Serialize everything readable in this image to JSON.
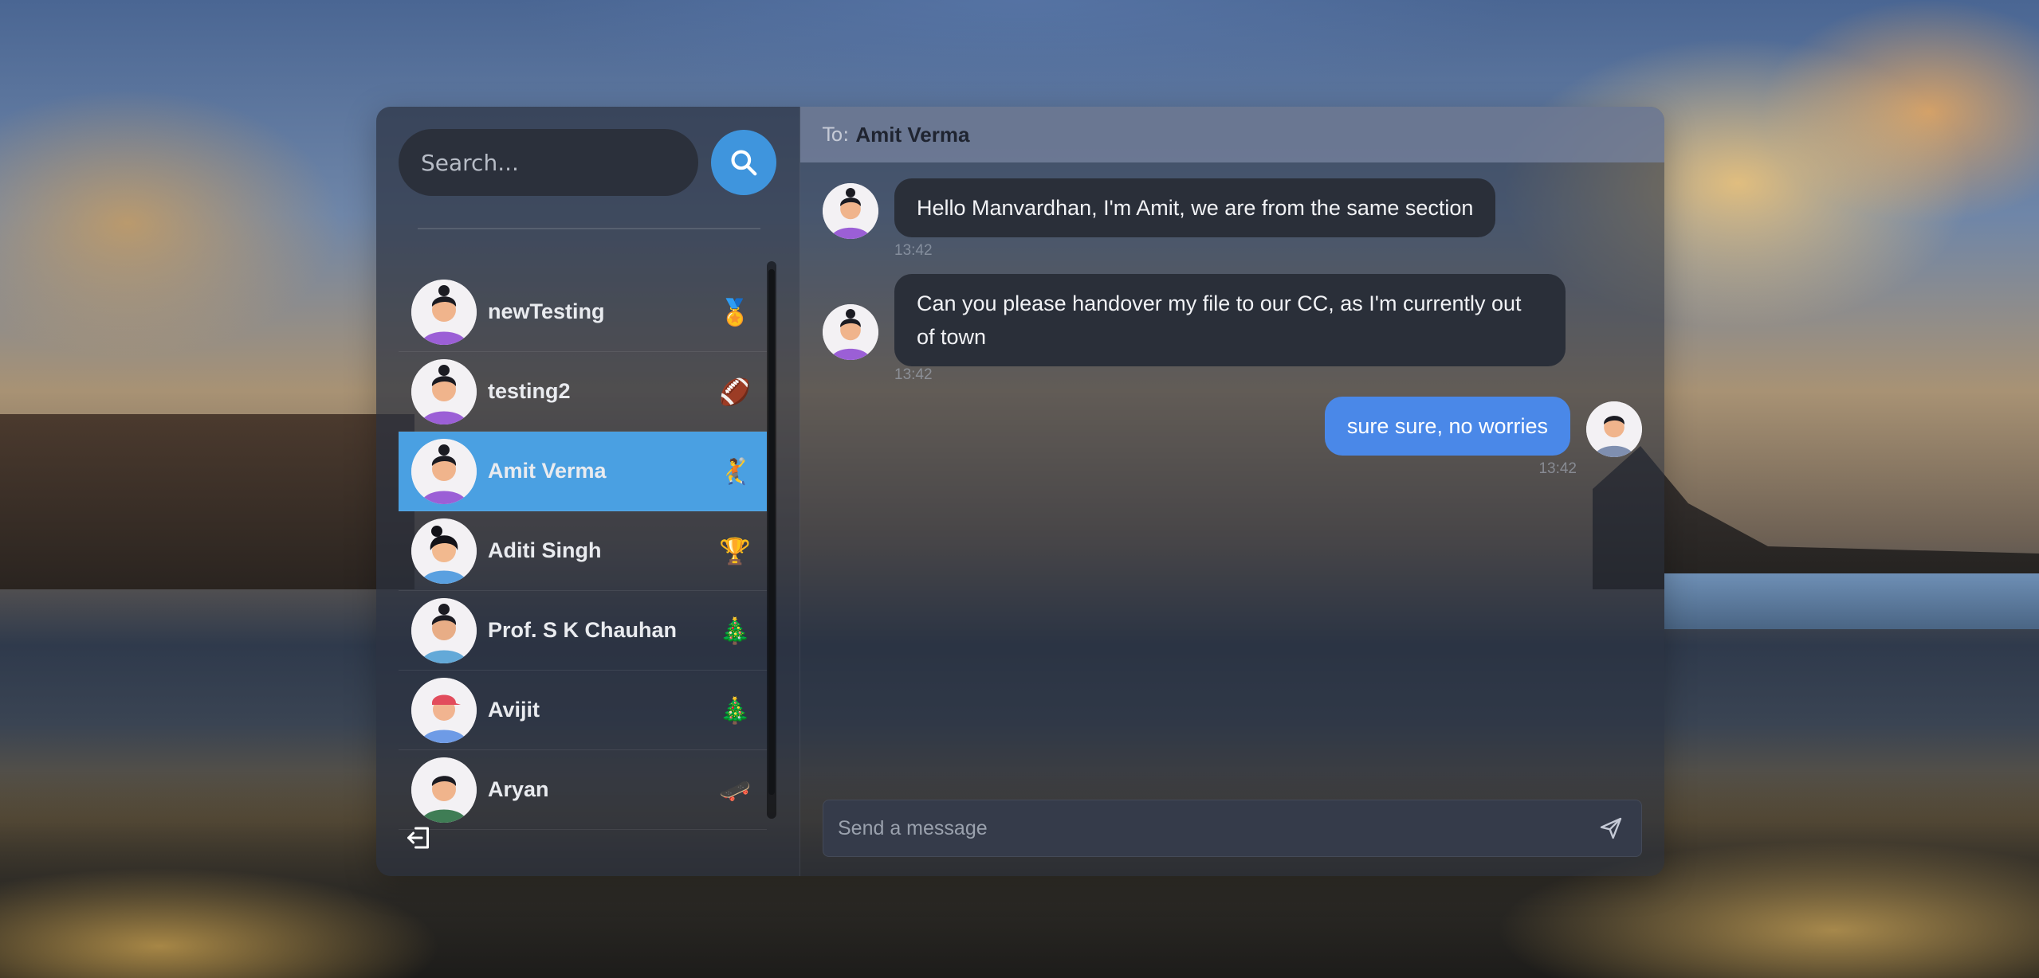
{
  "search": {
    "placeholder": "Search...",
    "button_icon": "search-icon"
  },
  "contacts": [
    {
      "name": "newTesting",
      "emoji": "🏅",
      "active": false
    },
    {
      "name": "testing2",
      "emoji": "🏈",
      "active": false
    },
    {
      "name": "Amit Verma",
      "emoji": "🤾",
      "active": true
    },
    {
      "name": "Aditi Singh",
      "emoji": "🏆",
      "active": false
    },
    {
      "name": "Prof. S K Chauhan",
      "emoji": "🎄",
      "active": false
    },
    {
      "name": "Avijit",
      "emoji": "🎄",
      "active": false
    },
    {
      "name": "Aryan",
      "emoji": "🛹",
      "active": false
    }
  ],
  "sidebar": {
    "logout_icon": "logout-icon"
  },
  "chat": {
    "to_label": "To:",
    "to_name": "Amit Verma",
    "messages": [
      {
        "direction": "in",
        "text": "Hello Manvardhan, I'm Amit, we are from the same section",
        "time": "13:42"
      },
      {
        "direction": "in",
        "text": "Can you please handover my file to our CC, as I'm currently out of town",
        "time": "13:42"
      },
      {
        "direction": "out",
        "text": "sure sure, no worries",
        "time": "13:42"
      }
    ],
    "composer_placeholder": "Send a message",
    "send_icon": "send-icon"
  },
  "colors": {
    "accent": "#4aa0e2",
    "outgoing_bubble": "#4a88e8",
    "incoming_bubble": "#2a2f39"
  }
}
